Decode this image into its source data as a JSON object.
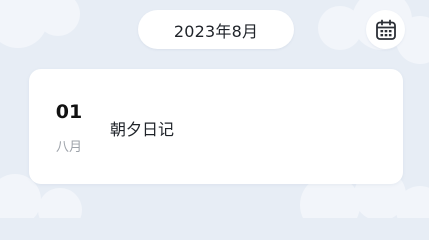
{
  "header": {
    "month_label": "2023年8月",
    "calendar_icon": "calendar-icon"
  },
  "entries": [
    {
      "day": "01",
      "month": "八月",
      "title": "朝夕日记"
    }
  ],
  "colors": {
    "background": "#e7edf5",
    "card": "#ffffff",
    "cloud": "#f2f5fa",
    "text_primary": "#1f2329",
    "text_secondary": "#9ea3aa"
  }
}
